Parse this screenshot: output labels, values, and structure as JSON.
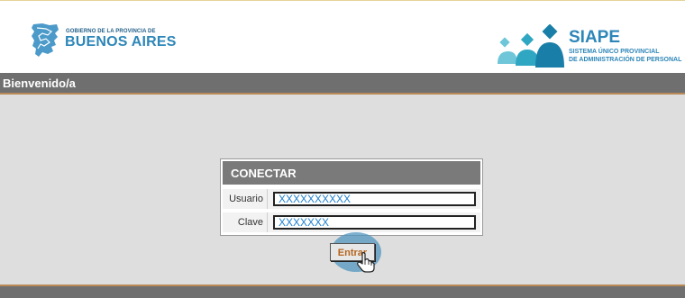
{
  "header": {
    "gov_line": "GOBIERNO DE LA PROVINCIA DE",
    "gov_name": "BUENOS AIRES",
    "app_name": "SIAPE",
    "app_sub1": "SISTEMA ÚNICO PROVINCIAL",
    "app_sub2": "DE ADMINISTRACIÓN DE PERSONAL"
  },
  "titlebar": {
    "label": "Bienvenido/a"
  },
  "login": {
    "title": "CONECTAR",
    "user_label": "Usuario",
    "user_value": "XXXXXXXXXX",
    "pass_label": "Clave",
    "pass_value": "XXXXXXX",
    "submit_label": "Entrar"
  },
  "colors": {
    "accent_blue": "#2d86b8",
    "bar_gray": "#6f6f6f",
    "content_bg": "#dedede",
    "submit_text": "#b5651d",
    "cursor_halo": "#5096be"
  },
  "icons": [
    "buenos-aires-map-logo",
    "siape-people-logo",
    "hand-pointer-cursor"
  ]
}
